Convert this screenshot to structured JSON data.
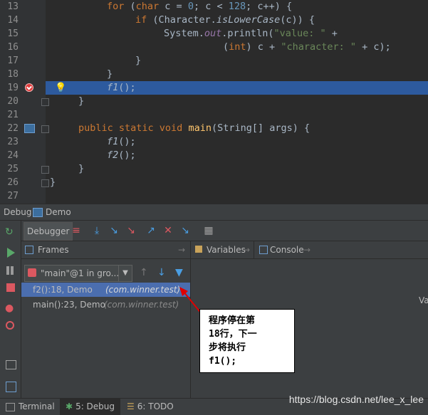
{
  "editor": {
    "lines": [
      {
        "n": "13"
      },
      {
        "n": "14"
      },
      {
        "n": "15"
      },
      {
        "n": "16"
      },
      {
        "n": "17"
      },
      {
        "n": "18"
      },
      {
        "n": "19"
      },
      {
        "n": "20"
      },
      {
        "n": "21"
      },
      {
        "n": "22"
      },
      {
        "n": "23"
      },
      {
        "n": "24"
      },
      {
        "n": "25"
      },
      {
        "n": "26"
      },
      {
        "n": "27"
      }
    ]
  },
  "debug": {
    "title": "Debug",
    "config": "Demo",
    "tab_debugger": "Debugger",
    "frames_label": "Frames",
    "variables_label": "Variables",
    "console_label": "Console",
    "thread": "\"main\"@1 in gro...",
    "frames": [
      {
        "method": "f2():18, Demo",
        "pkg": "(com.winner.test)"
      },
      {
        "method": "main():23, Demo",
        "pkg": "(com.winner.test)"
      }
    ],
    "vars_partial": "Va"
  },
  "annotation": {
    "line1": "程序停在第",
    "line2": "18行，下一",
    "line3": "步将执行",
    "line4": "f1();"
  },
  "bottom_tabs": [
    {
      "label": "Terminal"
    },
    {
      "label": "5: Debug"
    },
    {
      "label": "6: TODO"
    }
  ],
  "watermark": "https://blog.csdn.net/lee_x_lee",
  "colors": {
    "highlight": "#2d5a9e",
    "keyword": "#cc7832",
    "string": "#6a8759"
  }
}
